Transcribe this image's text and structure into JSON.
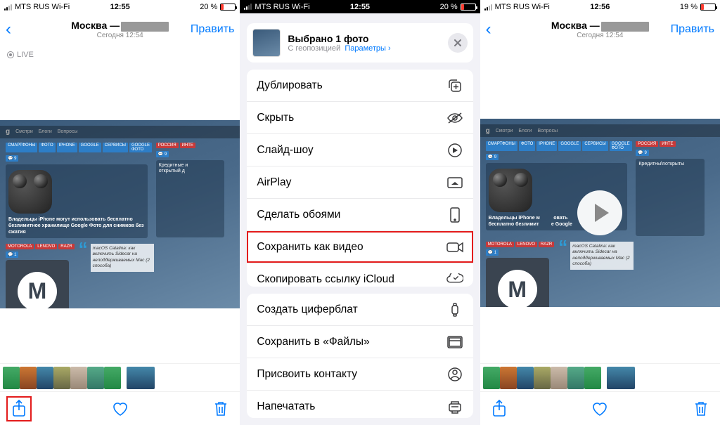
{
  "panes": {
    "left": {
      "status": {
        "carrier": "MTS RUS Wi-Fi",
        "time": "12:55",
        "battery_pct": "20 %",
        "battery_fill": 20
      },
      "nav": {
        "title_prefix": "Москва —",
        "subtitle": "Сегодня 12:54",
        "edit": "Править"
      },
      "live": "LIVE",
      "toolbar": {
        "share": "share",
        "like": "like",
        "trash": "trash"
      },
      "photo": {
        "nav_items": [
          "Смотри",
          "Блоги",
          "Вопросы"
        ],
        "tags_a": [
          "СМАРТФОНЫ",
          "ФОТО",
          "IPHONE",
          "GOOGLE",
          "СЕРВИСЫ",
          "GOOGLE ФОТО"
        ],
        "tags_b": [
          "РОССИЯ",
          "ИНТЕ"
        ],
        "count_a": "9",
        "count_b": "9",
        "hl_a": "Владельцы iPhone могут использовать бесплатно безлимитное хранилище Google Фото для снимков без сжатия",
        "hl_b": "Кредитные и\nоткрытый д",
        "tags_c": [
          "MOTOROLA",
          "LENOVO",
          "RAZR"
        ],
        "count_c": "1",
        "quote": "macOS Catalina: как включить Sidecar на неподдерживаемых Mac (2 способа)"
      }
    },
    "mid": {
      "status": {
        "carrier": "MTS RUS Wi-Fi",
        "time": "12:55",
        "battery_pct": "20 %",
        "battery_fill": 20
      },
      "sheet": {
        "title": "Выбрано 1 фото",
        "sub_a": "С геопозицией",
        "sub_b": "Параметры ›"
      },
      "actions_a": [
        "Дублировать",
        "Скрыть",
        "Слайд-шоу",
        "AirPlay",
        "Сделать обоями",
        "Сохранить как видео",
        "Скопировать ссылку iCloud"
      ],
      "actions_b": [
        "Создать циферблат",
        "Сохранить в «Файлы»",
        "Присвоить контакту",
        "Напечатать"
      ],
      "highlight_index": 5
    },
    "right": {
      "status": {
        "carrier": "MTS RUS Wi-Fi",
        "time": "12:56",
        "battery_pct": "19 %",
        "battery_fill": 19
      },
      "nav": {
        "title_prefix": "Москва —",
        "subtitle": "Сегодня 12:54",
        "edit": "Править"
      }
    }
  }
}
